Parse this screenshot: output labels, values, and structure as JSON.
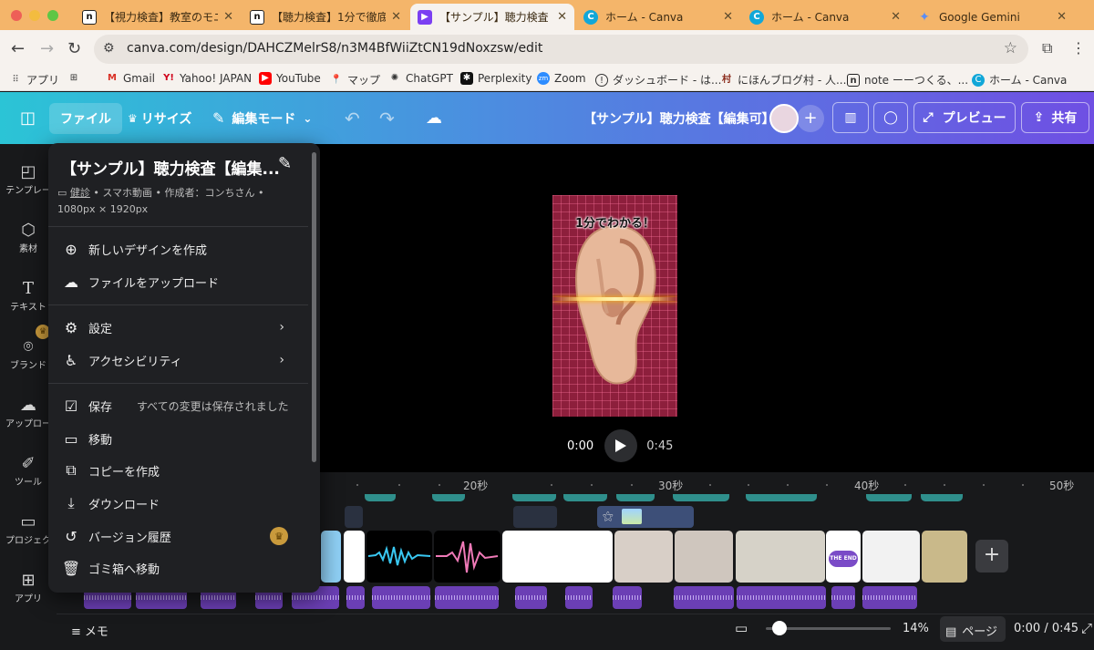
{
  "browser": {
    "tabs": [
      {
        "title": "【視力検査】教室のモニタ",
        "favicon": "note"
      },
      {
        "title": "【聴力検査】1分で徹底！",
        "favicon": "note"
      },
      {
        "title": "【サンプル】聴力検査【編",
        "favicon": "canva-video",
        "active": true
      },
      {
        "title": "ホーム - Canva",
        "favicon": "canva"
      },
      {
        "title": "ホーム - Canva",
        "favicon": "canva"
      },
      {
        "title": "Google Gemini",
        "favicon": "gemini"
      }
    ],
    "url": "canva.com/design/DAHCZMelrS8/n3M4BfWiiZtCN19dNoxzsw/edit",
    "bookmarks": [
      "アプリ",
      "Gmail",
      "Yahoo! JAPAN",
      "YouTube",
      "マップ",
      "ChatGPT",
      "Perplexity",
      "Zoom",
      "ダッシュボード - は...",
      "にほんブログ村 - 人...",
      "note ーーつくる、...",
      "ホーム - Canva"
    ]
  },
  "canva_toolbar": {
    "file": "ファイル",
    "resize": "リサイズ",
    "edit_mode": "編集モード",
    "doc_title": "【サンプル】聴力検査【編集可】",
    "preview": "プレビュー",
    "share": "共有",
    "accent": "#6f4fe3"
  },
  "rail": [
    {
      "label": "テンプレー",
      "icon": "template-icon"
    },
    {
      "label": "素材",
      "icon": "elements-icon"
    },
    {
      "label": "テキスト",
      "icon": "text-icon"
    },
    {
      "label": "ブランド",
      "icon": "brand-icon"
    },
    {
      "label": "アップロー",
      "icon": "upload-icon"
    },
    {
      "label": "ツール",
      "icon": "tools-icon"
    },
    {
      "label": "プロジェク",
      "icon": "folder-icon"
    },
    {
      "label": "アプリ",
      "icon": "apps-icon"
    }
  ],
  "canvas": {
    "design_text": "1分でわかる！",
    "current_time": "0:00",
    "duration": "0:45"
  },
  "timeline": {
    "ticks": [
      "20秒",
      "30秒",
      "40秒",
      "50秒"
    ],
    "end_clip_text": "THE END"
  },
  "bottom": {
    "notes": "メモ",
    "zoom": "14%",
    "pages": "ページ",
    "time": "0:00 / 0:45",
    "zoom_fraction": 0.0
  },
  "file_menu": {
    "title": "【サンプル】聴力検査【編集...",
    "meta_folder": "健診",
    "meta_rest": " • スマホ動画 • 作成者：コンちさん • 1080px × 1920px",
    "items": {
      "new_design": "新しいデザインを作成",
      "upload": "ファイルをアップロード",
      "settings": "設定",
      "accessibility": "アクセシビリティ",
      "save": "保存",
      "save_status": "すべての変更は保存されました",
      "move": "移動",
      "copy": "コピーを作成",
      "download": "ダウンロード",
      "version_history": "バージョン履歴",
      "trash": "ゴミ箱へ移動"
    }
  }
}
